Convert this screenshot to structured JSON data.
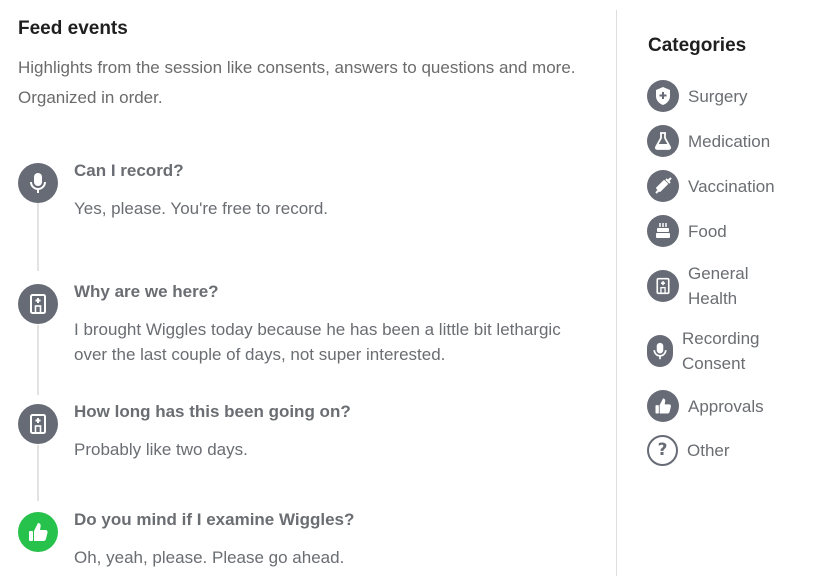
{
  "feed": {
    "title": "Feed events",
    "subtitle": "Highlights from the session like consents, answers to questions and more. Organized in order.",
    "events": [
      {
        "question": "Can I record?",
        "answer": "Yes, please. You're free to record.",
        "icon": "microphone-icon"
      },
      {
        "question": "Why are we here?",
        "answer": "I brought Wiggles today because he has been a little bit lethargic over the last couple of days, not super interested.",
        "icon": "hospital-icon"
      },
      {
        "question": "How long has this been going on?",
        "answer": "Probably like two days.",
        "icon": "hospital-icon"
      },
      {
        "question": "Do you mind if I examine Wiggles?",
        "answer": "Oh, yeah, please. Please go ahead.",
        "icon": "thumbs-up-icon",
        "accent": "#27c24c"
      }
    ]
  },
  "categories": {
    "title": "Categories",
    "items": [
      {
        "label": "Surgery",
        "icon": "shield-plus-icon"
      },
      {
        "label": "Medication",
        "icon": "flask-icon"
      },
      {
        "label": "Vaccination",
        "icon": "syringe-icon"
      },
      {
        "label": "Food",
        "icon": "cake-icon"
      },
      {
        "label": "General Health",
        "icon": "hospital-icon"
      },
      {
        "label": "Recording Consent",
        "icon": "microphone-icon"
      },
      {
        "label": "Approvals",
        "icon": "thumbs-up-icon"
      },
      {
        "label": "Other",
        "icon": "question-icon"
      }
    ]
  },
  "colors": {
    "icon_gray": "#676b75",
    "approval_green": "#27c24c",
    "text_gray": "#6a6d72"
  }
}
